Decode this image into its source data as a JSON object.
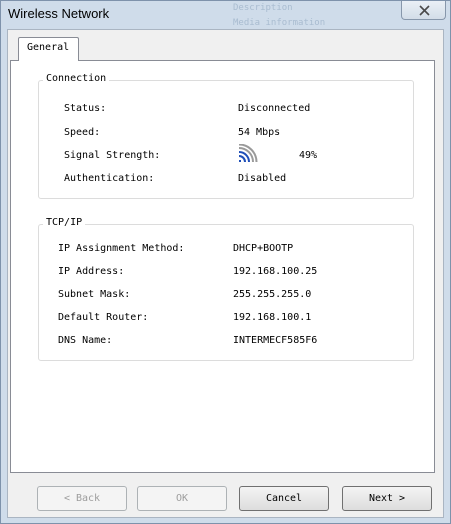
{
  "window": {
    "title": "Wireless Network",
    "background_hint_1": "Description",
    "background_hint_2": "Media information"
  },
  "tabs": [
    {
      "label": "General",
      "selected": true
    }
  ],
  "connection": {
    "heading": "Connection",
    "status_label": "Status:",
    "status_value": "Disconnected",
    "speed_label": "Speed:",
    "speed_value": "54 Mbps",
    "signal_label": "Signal Strength:",
    "signal_value": "49%",
    "signal_icon": "wifi-signal-icon",
    "auth_label": "Authentication:",
    "auth_value": "Disabled"
  },
  "tcpip": {
    "heading": "TCP/IP",
    "method_label": "IP Assignment Method:",
    "method_value": "DHCP+BOOTP",
    "ip_label": "IP Address:",
    "ip_value": "192.168.100.25",
    "mask_label": "Subnet Mask:",
    "mask_value": "255.255.255.0",
    "router_label": "Default Router:",
    "router_value": "192.168.100.1",
    "dns_label": "DNS Name:",
    "dns_value": "INTERMECF585F6"
  },
  "buttons": {
    "back": "< Back",
    "ok": "OK",
    "cancel": "Cancel",
    "next": "Next >"
  },
  "colors": {
    "signal_active": "#1f4fb8",
    "signal_inactive": "#9a9a9a"
  }
}
